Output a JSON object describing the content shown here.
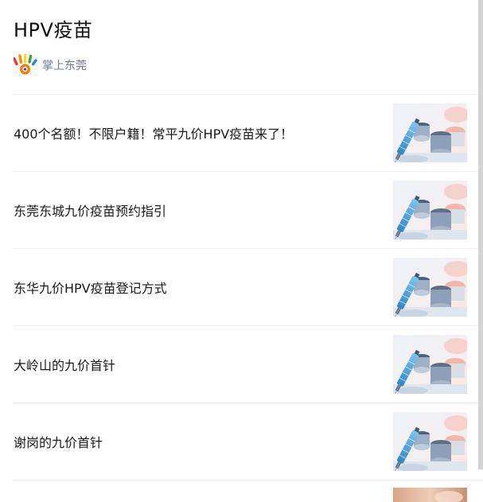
{
  "header": {
    "title": "HPV疫苗",
    "source_name": "掌上东莞",
    "source_logo_icon": "colorful-hand-icon"
  },
  "articles": [
    {
      "title": "400个名额！不限户籍！常平九价HPV疫苗来了！",
      "thumbnail_icon": "vaccine-syringe-thumbnail"
    },
    {
      "title": "东莞东城九价疫苗预约指引",
      "thumbnail_icon": "vaccine-syringe-thumbnail"
    },
    {
      "title": "东华九价HPV疫苗登记方式",
      "thumbnail_icon": "vaccine-syringe-thumbnail"
    },
    {
      "title": "大岭山的九价首针",
      "thumbnail_icon": "vaccine-syringe-thumbnail"
    },
    {
      "title": "谢岗的九价首针",
      "thumbnail_icon": "vaccine-syringe-thumbnail"
    }
  ],
  "colors": {
    "title_text": "#111111",
    "source_text": "#6e7a90",
    "divider": "#eeeeee",
    "scrollbar": "#d4d4d4"
  }
}
